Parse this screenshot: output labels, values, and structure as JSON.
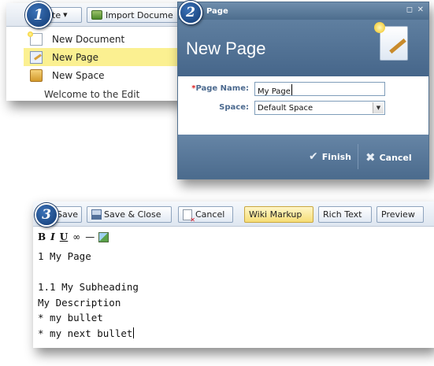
{
  "step_badges": [
    "1",
    "2",
    "3"
  ],
  "panel1": {
    "toolbar": {
      "create_label": "te",
      "import_label": "Import Docume"
    },
    "menu_items": [
      {
        "label": "New Document",
        "icon": "new-document-icon",
        "selected": false
      },
      {
        "label": "New Page",
        "icon": "new-page-icon",
        "selected": true
      },
      {
        "label": "New Space",
        "icon": "new-space-icon",
        "selected": false
      }
    ],
    "background_text": "Welcome to the Edit"
  },
  "panel2": {
    "window_title": "Page",
    "heading": "New Page",
    "fields": {
      "page_name_label": "Page Name:",
      "page_name_required": "*",
      "page_name_value": "My Page",
      "space_label": "Space:",
      "space_value": "Default Space"
    },
    "buttons": {
      "finish": "Finish",
      "cancel": "Cancel"
    }
  },
  "panel3": {
    "toolbar": {
      "save": "Save",
      "save_close": "Save & Close",
      "cancel": "Cancel",
      "wiki_markup": "Wiki Markup",
      "rich_text": "Rich Text",
      "preview": "Preview"
    },
    "format_buttons": {
      "bold": "B",
      "italic": "I",
      "underline": "U",
      "link": "∞",
      "hr": "—"
    },
    "editor_lines": [
      "1 My Page",
      "",
      "1.1 My Subheading",
      "My Description",
      "* my bullet",
      "* my next bullet"
    ]
  },
  "colors": {
    "dialog_blue": "#4d6d8d",
    "highlight_yellow": "#fbf091",
    "label_blue": "#4c6a8f",
    "required_red": "#dd2222"
  }
}
